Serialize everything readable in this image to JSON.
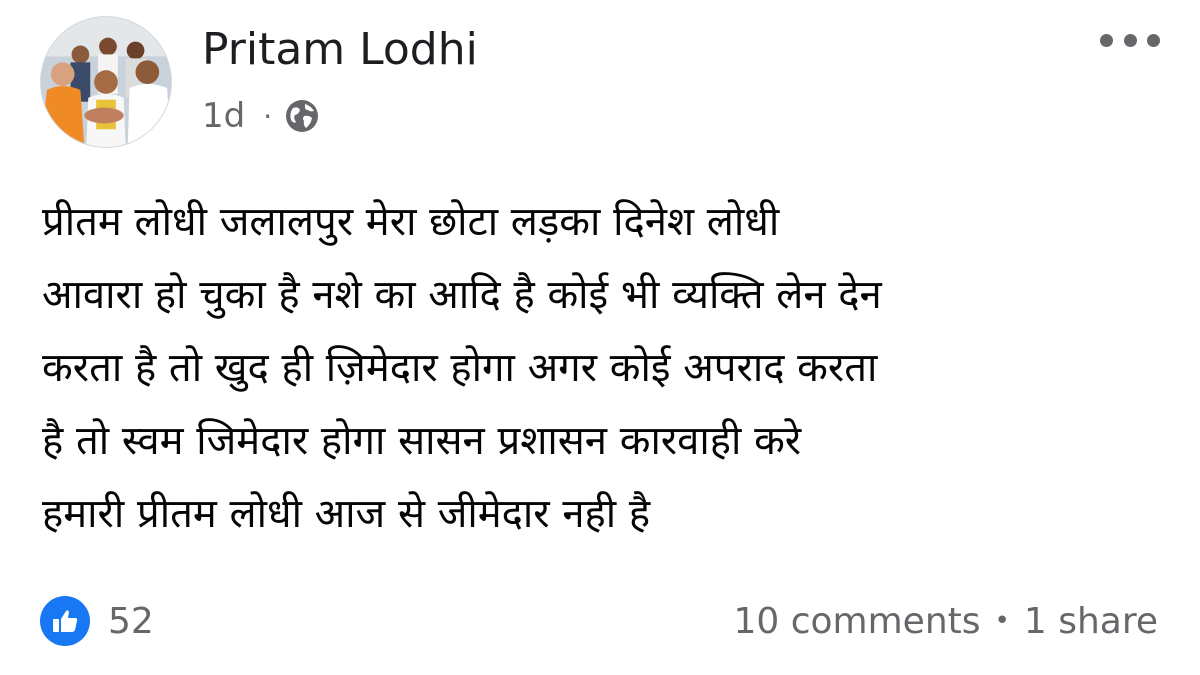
{
  "post": {
    "author": "Pritam Lodhi",
    "timestamp": "1d",
    "separator": "·",
    "privacy_icon": "globe-icon",
    "menu_icon": "more-options-icon",
    "text_lines": [
      "प्रीतम लोधी जलालपुर मेरा छोटा लड़का दिनेश लोधी",
      "आवारा हो चुका है नशे का आदि है कोई भी व्यक्ति लेन देन",
      "करता है तो खुद ही ज़िमेदार होगा अगर कोई अपराद करता",
      "है तो स्वम जिमेदार होगा सासन प्रशासन कारवाही करे",
      "हमारी प्रीतम लोधी आज से जीमेदार नही है"
    ]
  },
  "footer": {
    "reaction_icon": "like-icon",
    "reaction_count": "52",
    "comments": "10 comments",
    "bullet": "•",
    "shares": "1 share"
  },
  "colors": {
    "accent": "#1877f2",
    "secondary_text": "#65676b",
    "primary_text": "#050505"
  }
}
